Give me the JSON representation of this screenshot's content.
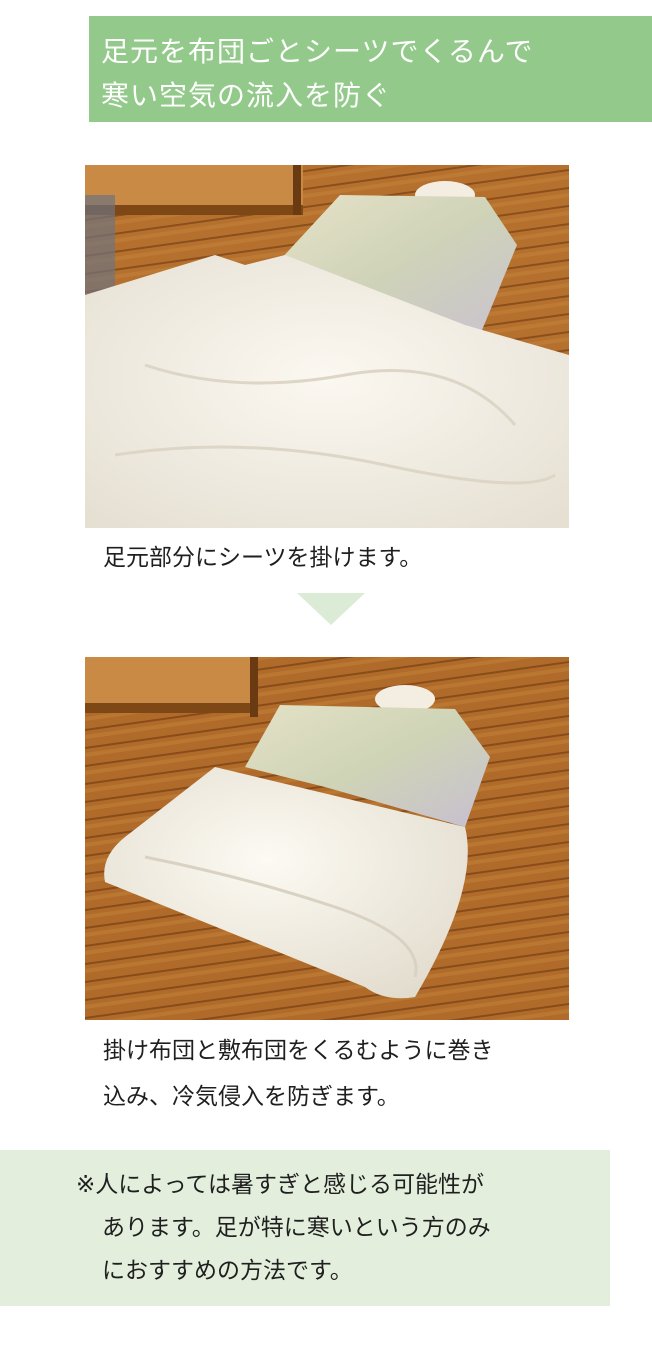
{
  "header": {
    "line1": "足元を布団ごとシーツでくるんで",
    "line2": "寒い空気の流入を防ぐ",
    "bg_color": "#93c98a"
  },
  "step1": {
    "caption": "足元部分にシーツを掛けます。"
  },
  "arrow": {
    "color": "#dcebd6",
    "icon": "down-triangle-icon"
  },
  "step2": {
    "caption_line1": "掛け布団と敷布団をくるむように巻き",
    "caption_line2": "込み、冷気侵入を防ぎます。"
  },
  "note": {
    "line1": "※人によっては暑すぎと感じる可能性が",
    "line2": "あります。足が特に寒いという方のみ",
    "line3": "におすすめの方法です。",
    "bg_color": "#e3efdc"
  }
}
